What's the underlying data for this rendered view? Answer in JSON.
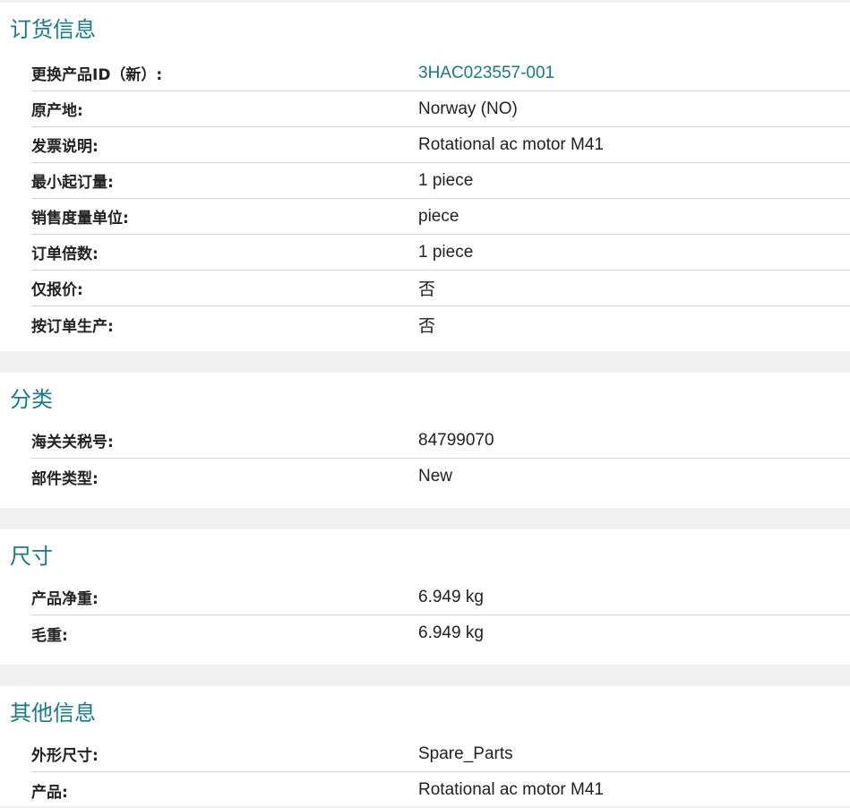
{
  "sections": [
    {
      "title": "订货信息",
      "rows": [
        {
          "label": "更换产品ID（新）:",
          "value": "3HAC023557-001"
        },
        {
          "label": "原产地:",
          "value": "Norway (NO)"
        },
        {
          "label": "发票说明:",
          "value": "Rotational ac motor M41"
        },
        {
          "label": "最小起订量:",
          "value": "1 piece"
        },
        {
          "label": "销售度量单位:",
          "value": "piece"
        },
        {
          "label": "订单倍数:",
          "value": "1 piece"
        },
        {
          "label": "仅报价:",
          "value": "否"
        },
        {
          "label": "按订单生产:",
          "value": "否"
        }
      ]
    },
    {
      "title": "分类",
      "rows": [
        {
          "label": "海关关税号:",
          "value": "84799070"
        },
        {
          "label": "部件类型:",
          "value": "New"
        }
      ]
    },
    {
      "title": "尺寸",
      "rows": [
        {
          "label": "产品净重:",
          "value": "6.949 kg"
        },
        {
          "label": "毛重:",
          "value": "6.949 kg"
        }
      ]
    },
    {
      "title": "其他信息",
      "rows": [
        {
          "label": "外形尺寸:",
          "value": "Spare_Parts"
        },
        {
          "label": "产品:",
          "value": "Rotational ac motor M41"
        }
      ]
    }
  ],
  "colors": {
    "accent": "#1a7a82",
    "separator": "#d6d6d6",
    "background": "#f0f0f0"
  }
}
